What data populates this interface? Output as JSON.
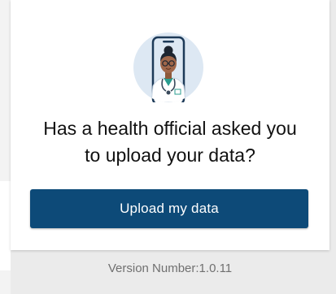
{
  "card": {
    "headline_line1": "Has a health official asked you",
    "headline_line2": "to upload your data?",
    "upload_button_label": "Upload my data",
    "avatar_icon": "health-official-icon"
  },
  "footer": {
    "version_text": "Version Number:1.0.11"
  },
  "colors": {
    "accent": "#0d4a78",
    "avatar_background": "#dde8f3"
  }
}
